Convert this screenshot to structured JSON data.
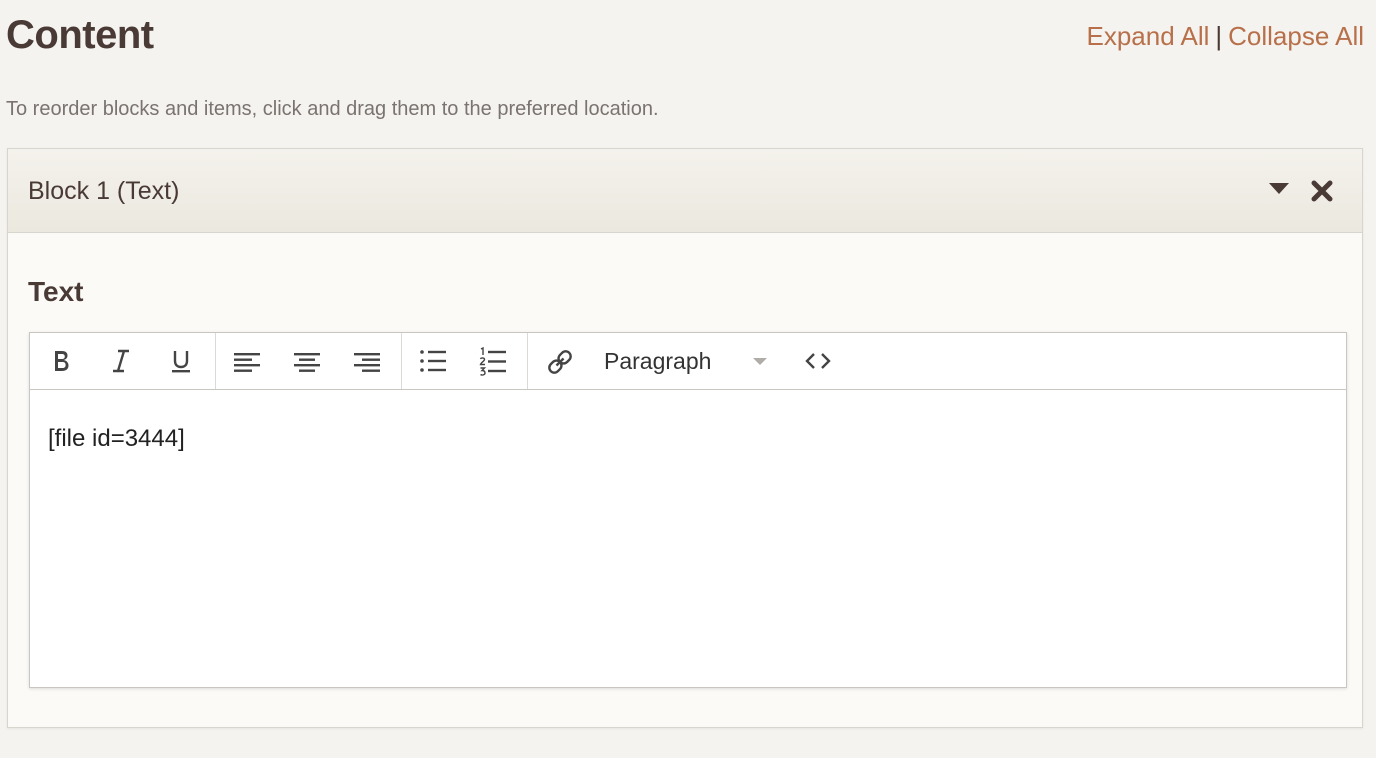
{
  "header": {
    "title": "Content",
    "expand_all": "Expand All",
    "separator": "|",
    "collapse_all": "Collapse All"
  },
  "instructions": "To reorder blocks and items, click and drag them to the preferred location.",
  "block": {
    "title": "Block 1 (Text)",
    "toggle_icon": "caret-down-icon",
    "close_icon": "close-icon",
    "field_label": "Text",
    "editor": {
      "toolbar": {
        "groups": [
          [
            "bold-icon",
            "italic-icon",
            "underline-icon"
          ],
          [
            "align-left-icon",
            "align-center-icon",
            "align-right-icon"
          ],
          [
            "bullet-list-icon",
            "numbered-list-icon"
          ],
          [
            "link-icon",
            "format-select",
            "code-icon"
          ]
        ],
        "format_value": "Paragraph"
      },
      "content": "[file id=3444]"
    }
  },
  "colors": {
    "background": "#f4f3ef",
    "text": "#4a3a35",
    "link": "#b8704a",
    "muted": "#7a7370",
    "border": "#d8d5cc"
  }
}
